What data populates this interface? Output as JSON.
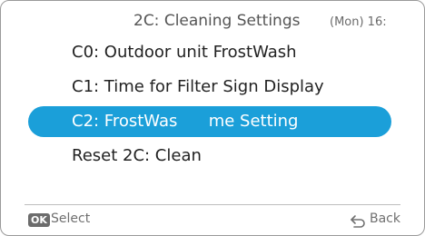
{
  "header": {
    "title": "2C: Cleaning Settings",
    "clock": "(Mon) 16:"
  },
  "menu": {
    "items": [
      {
        "label": "C0: Outdoor unit FrostWash",
        "selected": false
      },
      {
        "label": "C1: Time for Filter Sign Display",
        "selected": false
      },
      {
        "label": "C2: FrostWas      me Setting",
        "selected": true
      },
      {
        "label": "Reset 2C: Clean",
        "selected": false
      }
    ]
  },
  "footer": {
    "ok_key": "OK",
    "select_label": "Select",
    "back_label": "Back",
    "back_icon": "back-arrow-icon"
  },
  "colors": {
    "highlight": "#1b9fd9",
    "text": "#222222",
    "muted": "#707070"
  }
}
